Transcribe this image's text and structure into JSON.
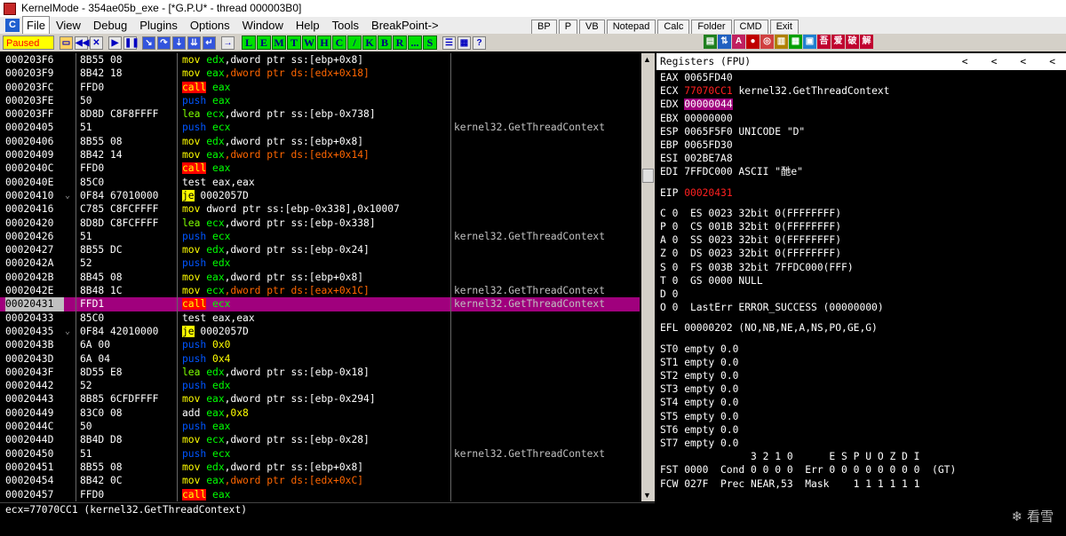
{
  "titlebar": {
    "title": "KernelMode - 354ae05b_exe - [*G.P.U* - thread 000003B0]"
  },
  "menu": [
    "File",
    "View",
    "Debug",
    "Plugins",
    "Options",
    "Window",
    "Help",
    "Tools",
    "BreakPoint->"
  ],
  "topbuttons": [
    "BP",
    "P",
    "VB",
    "Notepad",
    "Calc",
    "Folder",
    "CMD",
    "Exit"
  ],
  "toolbar": {
    "status": "Paused",
    "letters": [
      "L",
      "E",
      "M",
      "T",
      "W",
      "H",
      "C",
      "/",
      "K",
      "B",
      "R",
      "...",
      "S"
    ]
  },
  "disasm": [
    {
      "addr": "000203F6",
      "fold": "",
      "hex": "8B55 08",
      "asm": [
        [
          "m",
          "mov "
        ],
        [
          "r",
          "edx"
        ],
        [
          "tx",
          ",dword ptr ss:[ebp+0x8]"
        ]
      ],
      "cmt": ""
    },
    {
      "addr": "000203F9",
      "fold": "",
      "hex": "8B42 18",
      "asm": [
        [
          "m",
          "mov "
        ],
        [
          "r",
          "eax"
        ],
        [
          "nm",
          ",dword ptr ds:[edx+0x18]"
        ]
      ],
      "cmt": ""
    },
    {
      "addr": "000203FC",
      "fold": "",
      "hex": "FFD0",
      "asm": [
        [
          "cl",
          "call"
        ],
        [
          "tx",
          " "
        ],
        [
          "r",
          "eax"
        ]
      ],
      "cmt": ""
    },
    {
      "addr": "000203FE",
      "fold": "",
      "hex": "50",
      "asm": [
        [
          "ps",
          "push "
        ],
        [
          "r",
          "eax"
        ]
      ],
      "cmt": ""
    },
    {
      "addr": "000203FF",
      "fold": "",
      "hex": "8D8D C8F8FFFF",
      "asm": [
        [
          "ad",
          "lea "
        ],
        [
          "r",
          "ecx"
        ],
        [
          "tx",
          ",dword ptr ss:[ebp-0x738]"
        ]
      ],
      "cmt": ""
    },
    {
      "addr": "00020405",
      "fold": "",
      "hex": "51",
      "asm": [
        [
          "ps",
          "push "
        ],
        [
          "r",
          "ecx"
        ]
      ],
      "cmt": "kernel32.GetThreadContext"
    },
    {
      "addr": "00020406",
      "fold": "",
      "hex": "8B55 08",
      "asm": [
        [
          "m",
          "mov "
        ],
        [
          "r",
          "edx"
        ],
        [
          "tx",
          ",dword ptr ss:[ebp+0x8]"
        ]
      ],
      "cmt": ""
    },
    {
      "addr": "00020409",
      "fold": "",
      "hex": "8B42 14",
      "asm": [
        [
          "m",
          "mov "
        ],
        [
          "r",
          "eax"
        ],
        [
          "nm",
          ",dword ptr ds:[edx+0x14]"
        ]
      ],
      "cmt": ""
    },
    {
      "addr": "0002040C",
      "fold": "",
      "hex": "FFD0",
      "asm": [
        [
          "cl",
          "call"
        ],
        [
          "tx",
          " "
        ],
        [
          "r",
          "eax"
        ]
      ],
      "cmt": ""
    },
    {
      "addr": "0002040E",
      "fold": "",
      "hex": "85C0",
      "asm": [
        [
          "tx",
          "test eax,eax"
        ]
      ],
      "cmt": ""
    },
    {
      "addr": "00020410",
      "fold": "⌄",
      "hex": "0F84 67010000",
      "asm": [
        [
          "jc",
          "je"
        ],
        [
          "tx",
          " 0002057D"
        ]
      ],
      "cmt": ""
    },
    {
      "addr": "00020416",
      "fold": "",
      "hex": "C785 C8FCFFFF",
      "asm": [
        [
          "m",
          "mov "
        ],
        [
          "tx",
          "dword ptr ss:[ebp-0x338],0x10007"
        ]
      ],
      "cmt": ""
    },
    {
      "addr": "00020420",
      "fold": "",
      "hex": "8D8D C8FCFFFF",
      "asm": [
        [
          "ad",
          "lea "
        ],
        [
          "r",
          "ecx"
        ],
        [
          "tx",
          ",dword ptr ss:[ebp-0x338]"
        ]
      ],
      "cmt": ""
    },
    {
      "addr": "00020426",
      "fold": "",
      "hex": "51",
      "asm": [
        [
          "ps",
          "push "
        ],
        [
          "r",
          "ecx"
        ]
      ],
      "cmt": "kernel32.GetThreadContext"
    },
    {
      "addr": "00020427",
      "fold": "",
      "hex": "8B55 DC",
      "asm": [
        [
          "m",
          "mov "
        ],
        [
          "r",
          "edx"
        ],
        [
          "tx",
          ",dword ptr ss:[ebp-0x24]"
        ]
      ],
      "cmt": ""
    },
    {
      "addr": "0002042A",
      "fold": "",
      "hex": "52",
      "asm": [
        [
          "ps",
          "push "
        ],
        [
          "r",
          "edx"
        ]
      ],
      "cmt": ""
    },
    {
      "addr": "0002042B",
      "fold": "",
      "hex": "8B45 08",
      "asm": [
        [
          "m",
          "mov "
        ],
        [
          "r",
          "eax"
        ],
        [
          "tx",
          ",dword ptr ss:[ebp+0x8]"
        ]
      ],
      "cmt": ""
    },
    {
      "addr": "0002042E",
      "fold": "",
      "hex": "8B48 1C",
      "asm": [
        [
          "m",
          "mov "
        ],
        [
          "r",
          "ecx"
        ],
        [
          "nm",
          ",dword ptr ds:[eax+0x1C]"
        ]
      ],
      "cmt": "kernel32.GetThreadContext"
    },
    {
      "addr": "00020431",
      "fold": "",
      "hex": "FFD1",
      "asm": [
        [
          "cl",
          "call"
        ],
        [
          "tx",
          " "
        ],
        [
          "r",
          "ecx"
        ]
      ],
      "cmt": "kernel32.GetThreadContext",
      "sel": true
    },
    {
      "addr": "00020433",
      "fold": "",
      "hex": "85C0",
      "asm": [
        [
          "tx",
          "test eax,eax"
        ]
      ],
      "cmt": ""
    },
    {
      "addr": "00020435",
      "fold": "⌄",
      "hex": "0F84 42010000",
      "asm": [
        [
          "jc",
          "je"
        ],
        [
          "tx",
          " 0002057D"
        ]
      ],
      "cmt": ""
    },
    {
      "addr": "0002043B",
      "fold": "",
      "hex": "6A 00",
      "asm": [
        [
          "ps",
          "push "
        ],
        [
          "m",
          "0x0"
        ]
      ],
      "cmt": ""
    },
    {
      "addr": "0002043D",
      "fold": "",
      "hex": "6A 04",
      "asm": [
        [
          "ps",
          "push "
        ],
        [
          "m",
          "0x4"
        ]
      ],
      "cmt": ""
    },
    {
      "addr": "0002043F",
      "fold": "",
      "hex": "8D55 E8",
      "asm": [
        [
          "ad",
          "lea "
        ],
        [
          "r",
          "edx"
        ],
        [
          "tx",
          ",dword ptr ss:[ebp-0x18]"
        ]
      ],
      "cmt": ""
    },
    {
      "addr": "00020442",
      "fold": "",
      "hex": "52",
      "asm": [
        [
          "ps",
          "push "
        ],
        [
          "r",
          "edx"
        ]
      ],
      "cmt": ""
    },
    {
      "addr": "00020443",
      "fold": "",
      "hex": "8B85 6CFDFFFF",
      "asm": [
        [
          "m",
          "mov "
        ],
        [
          "r",
          "eax"
        ],
        [
          "tx",
          ",dword ptr ss:[ebp-0x294]"
        ]
      ],
      "cmt": ""
    },
    {
      "addr": "00020449",
      "fold": "",
      "hex": "83C0 08",
      "asm": [
        [
          "tx",
          "add "
        ],
        [
          "r",
          "eax"
        ],
        [
          "m",
          ",0x8"
        ]
      ],
      "cmt": ""
    },
    {
      "addr": "0002044C",
      "fold": "",
      "hex": "50",
      "asm": [
        [
          "ps",
          "push "
        ],
        [
          "r",
          "eax"
        ]
      ],
      "cmt": ""
    },
    {
      "addr": "0002044D",
      "fold": "",
      "hex": "8B4D D8",
      "asm": [
        [
          "m",
          "mov "
        ],
        [
          "r",
          "ecx"
        ],
        [
          "tx",
          ",dword ptr ss:[ebp-0x28]"
        ]
      ],
      "cmt": ""
    },
    {
      "addr": "00020450",
      "fold": "",
      "hex": "51",
      "asm": [
        [
          "ps",
          "push "
        ],
        [
          "r",
          "ecx"
        ]
      ],
      "cmt": "kernel32.GetThreadContext"
    },
    {
      "addr": "00020451",
      "fold": "",
      "hex": "8B55 08",
      "asm": [
        [
          "m",
          "mov "
        ],
        [
          "r",
          "edx"
        ],
        [
          "tx",
          ",dword ptr ss:[ebp+0x8]"
        ]
      ],
      "cmt": ""
    },
    {
      "addr": "00020454",
      "fold": "",
      "hex": "8B42 0C",
      "asm": [
        [
          "m",
          "mov "
        ],
        [
          "r",
          "eax"
        ],
        [
          "nm",
          ",dword ptr ds:[edx+0xC]"
        ]
      ],
      "cmt": ""
    },
    {
      "addr": "00020457",
      "fold": "",
      "hex": "FFD0",
      "asm": [
        [
          "cl",
          "call"
        ],
        [
          "tx",
          " "
        ],
        [
          "r",
          "eax"
        ]
      ],
      "cmt": ""
    }
  ],
  "info_line": "ecx=77070CC1 (kernel32.GetThreadContext)",
  "registers": {
    "header": "Registers (FPU)",
    "lines": [
      {
        "t": "EAX 0065FD40"
      },
      {
        "t": "ECX ",
        "v": "77070CC1",
        "vc": "red",
        "rest": " kernel32.GetThreadContext"
      },
      {
        "t": "EDX ",
        "v": "00000044",
        "vc": "hl",
        "rest": ""
      },
      {
        "t": "EBX 00000000"
      },
      {
        "t": "ESP 0065F5F0 UNICODE \"D\""
      },
      {
        "t": "EBP 0065FD30"
      },
      {
        "t": "ESI 002BE7A8"
      },
      {
        "t": "EDI 7FFDC000 ASCII \"酏e\""
      },
      {
        "t": "",
        "gap": true
      },
      {
        "t": "EIP ",
        "v": "00020431",
        "vc": "red",
        "rest": ""
      },
      {
        "t": "",
        "gap": true
      },
      {
        "t": "C 0  ES 0023 32bit 0(FFFFFFFF)"
      },
      {
        "t": "P 0  CS 001B 32bit 0(FFFFFFFF)"
      },
      {
        "t": "A 0  SS 0023 32bit 0(FFFFFFFF)"
      },
      {
        "t": "Z 0  DS 0023 32bit 0(FFFFFFFF)"
      },
      {
        "t": "S 0  FS 003B 32bit 7FFDC000(FFF)"
      },
      {
        "t": "T 0  GS 0000 NULL"
      },
      {
        "t": "D 0"
      },
      {
        "t": "O 0  LastErr ERROR_SUCCESS (00000000)"
      },
      {
        "t": "",
        "gap": true
      },
      {
        "t": "EFL 00000202 (NO,NB,NE,A,NS,PO,GE,G)"
      },
      {
        "t": "",
        "gap": true
      },
      {
        "t": "ST0 empty 0.0"
      },
      {
        "t": "ST1 empty 0.0"
      },
      {
        "t": "ST2 empty 0.0"
      },
      {
        "t": "ST3 empty 0.0"
      },
      {
        "t": "ST4 empty 0.0"
      },
      {
        "t": "ST5 empty 0.0"
      },
      {
        "t": "ST6 empty 0.0"
      },
      {
        "t": "ST7 empty 0.0"
      },
      {
        "t": "               3 2 1 0      E S P U O Z D I"
      },
      {
        "t": "FST 0000  Cond 0 0 0 0  Err 0 0 0 0 0 0 0 0  (GT)"
      },
      {
        "t": "FCW 027F  Prec NEAR,53  Mask    1 1 1 1 1 1"
      }
    ]
  },
  "watermark": "看雪"
}
